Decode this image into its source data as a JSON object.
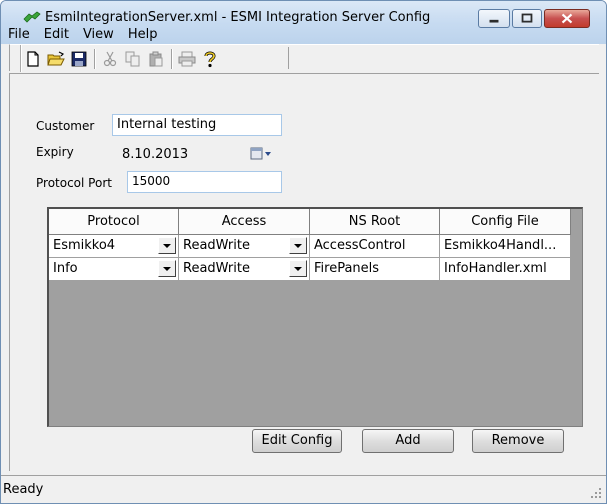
{
  "window": {
    "title": "EsmiIntegrationServer.xml - ESMI Integration Server Config",
    "icon": "green-plug-icon"
  },
  "menu": [
    "File",
    "Edit",
    "View",
    "Help"
  ],
  "toolbar": {
    "icons": [
      "new-file-icon",
      "open-folder-icon",
      "save-icon",
      "cut-icon",
      "copy-icon",
      "paste-icon",
      "print-icon",
      "help-icon"
    ]
  },
  "form": {
    "customer_label": "Customer",
    "customer_value": "Internal testing",
    "expiry_label": "Expiry",
    "expiry_value": "8.10.2013",
    "port_label": "Protocol Port",
    "port_value": "15000"
  },
  "grid": {
    "headers": [
      "Protocol",
      "Access",
      "NS Root",
      "Config File"
    ],
    "rows": [
      [
        "Esmikko4",
        "ReadWrite",
        "AccessControl",
        "Esmikko4Handl..."
      ],
      [
        "Info",
        "ReadWrite",
        "FirePanels",
        "InfoHandler.xml"
      ]
    ]
  },
  "buttons": {
    "edit_config": "Edit Config",
    "add": "Add",
    "remove": "Remove"
  },
  "status": {
    "text": "Ready"
  },
  "colors": {
    "titlebar": "#c7dbf1",
    "close_button": "#c75050",
    "grid_background": "#a0a0a0"
  }
}
